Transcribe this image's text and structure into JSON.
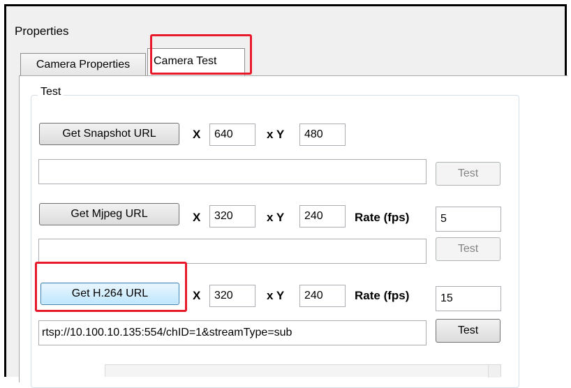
{
  "window": {
    "title": "Properties"
  },
  "tabs": [
    {
      "label": "Camera Properties",
      "active": false
    },
    {
      "label": "Camera Test",
      "active": true
    }
  ],
  "group": {
    "title": "Test"
  },
  "snapshot": {
    "button": "Get Snapshot URL",
    "x_label": "X",
    "x_value": "640",
    "y_label": "x Y",
    "y_value": "480",
    "url": "",
    "test_button": "Test"
  },
  "mjpeg": {
    "button": "Get Mjpeg URL",
    "x_label": "X",
    "x_value": "320",
    "y_label": "x Y",
    "y_value": "240",
    "rate_label": "Rate (fps)",
    "rate_value": "5",
    "url": "",
    "test_button": "Test"
  },
  "h264": {
    "button": "Get H.264 URL",
    "x_label": "X",
    "x_value": "320",
    "y_label": "x Y",
    "y_value": "240",
    "rate_label": "Rate (fps)",
    "rate_value": "15",
    "url": "rtsp://10.100.10.135:554/chID=1&streamType=sub",
    "test_button": "Test"
  },
  "colors": {
    "highlight": "#e8192b",
    "focus_button": "#bee6fd"
  }
}
